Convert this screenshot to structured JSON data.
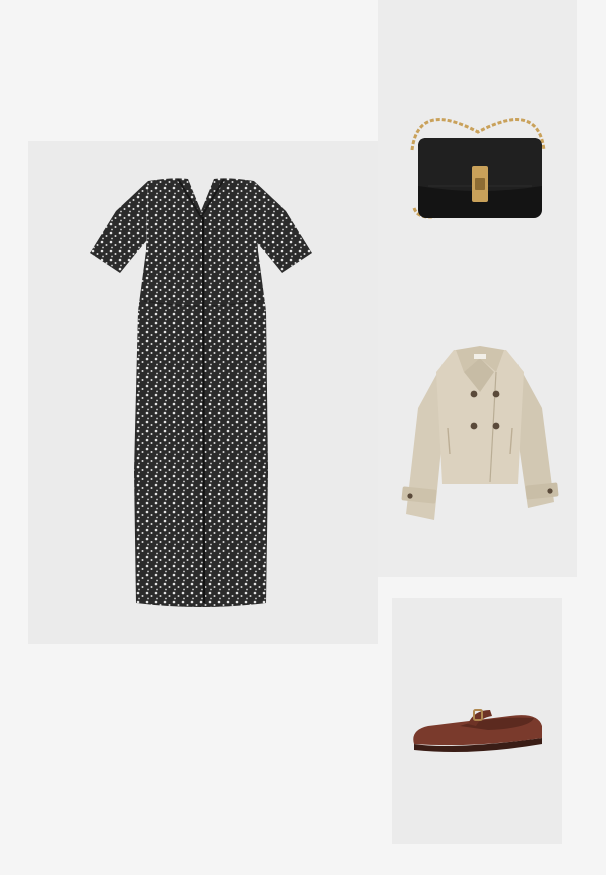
{
  "collage": {
    "background_color": "#f5f5f5",
    "items": [
      {
        "id": "dress",
        "product": "floral-print-midi-dress",
        "colors": {
          "primary": "#2b2b2b",
          "pattern": "#e8e8e8"
        }
      },
      {
        "id": "bag",
        "product": "black-chain-strap-shoulder-bag",
        "colors": {
          "primary": "#141414",
          "hardware": "#c9a15a"
        }
      },
      {
        "id": "coat",
        "product": "beige-cropped-double-breasted-trench-jacket",
        "colors": {
          "primary": "#d6ccb8",
          "buttons": "#5a4a3a"
        }
      },
      {
        "id": "shoe",
        "product": "burgundy-suede-mary-jane-flat",
        "colors": {
          "primary": "#7a3a2c",
          "buckle": "#b08850"
        }
      }
    ]
  }
}
